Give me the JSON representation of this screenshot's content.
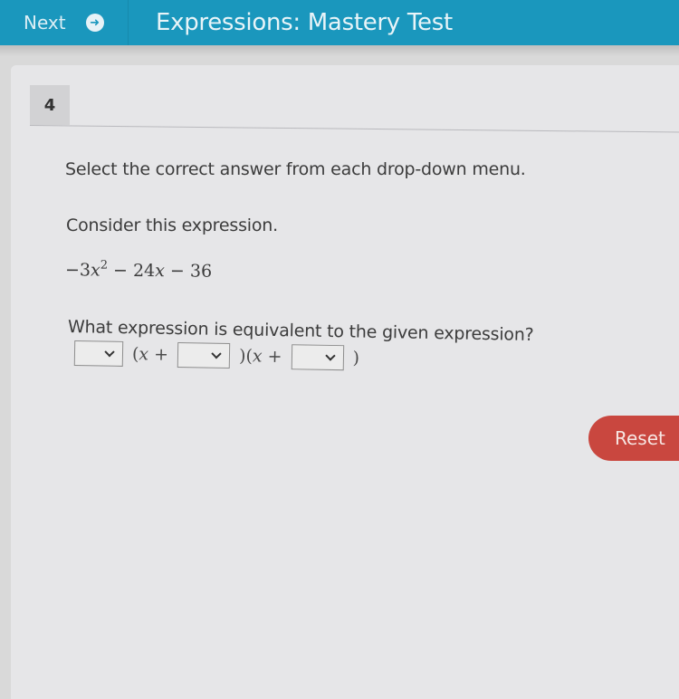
{
  "header": {
    "next_label": "Next",
    "next_icon": "arrow-circle-right-icon",
    "title": "Expressions: Mastery Test"
  },
  "question": {
    "number": "4",
    "instruction": "Select the correct answer from each drop-down menu.",
    "prompt": "Consider this expression.",
    "expression": {
      "term1_coef": "−3",
      "term1_var": "x",
      "term1_exp": "2",
      "op1": " − ",
      "term2": "24",
      "term2_var": "x",
      "op2": " − ",
      "term3": "36"
    },
    "ask": "What expression is equivalent to the given expression?",
    "answer": {
      "dropdown1_value": "",
      "part1_open": "(",
      "part1_var": "x",
      "part1_plus": " +",
      "dropdown2_value": "",
      "part2_close_open": ")(",
      "part2_var": "x",
      "part2_plus": " +",
      "dropdown3_value": "",
      "part3_close": ")"
    }
  },
  "actions": {
    "reset_label": "Reset",
    "reset_color": "#c9473f"
  },
  "theme": {
    "header_color": "#1a97bd"
  }
}
